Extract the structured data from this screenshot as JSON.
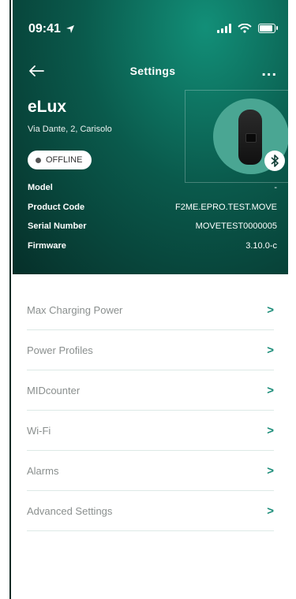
{
  "status_bar": {
    "time": "09:41"
  },
  "nav": {
    "title": "Settings",
    "more": "..."
  },
  "device": {
    "name": "eLux",
    "address": "Via Dante, 2, Carisolo",
    "status": "OFFLINE"
  },
  "info": [
    {
      "label": "Model",
      "value": "-"
    },
    {
      "label": "Product Code",
      "value": "F2ME.EPRO.TEST.MOVE"
    },
    {
      "label": "Serial Number",
      "value": "MOVETEST0000005"
    },
    {
      "label": "Firmware",
      "value": "3.10.0-c"
    }
  ],
  "menu": [
    {
      "label": "Max Charging Power",
      "chevron": ">"
    },
    {
      "label": "Power Profiles",
      "chevron": ">"
    },
    {
      "label": "MIDcounter",
      "chevron": ">"
    },
    {
      "label": "Wi-Fi",
      "chevron": ">"
    },
    {
      "label": "Alarms",
      "chevron": ">"
    },
    {
      "label": "Advanced Settings",
      "chevron": ">"
    }
  ],
  "colors": {
    "header_dark": "#062f29",
    "header_light": "#128f78",
    "accent": "#1a8c78",
    "menu_text": "#8a8f8e"
  },
  "icons": [
    "back-arrow-icon",
    "location-arrow-icon",
    "signal-icon",
    "wifi-icon",
    "battery-icon",
    "bluetooth-icon",
    "chevron-right-icon"
  ]
}
